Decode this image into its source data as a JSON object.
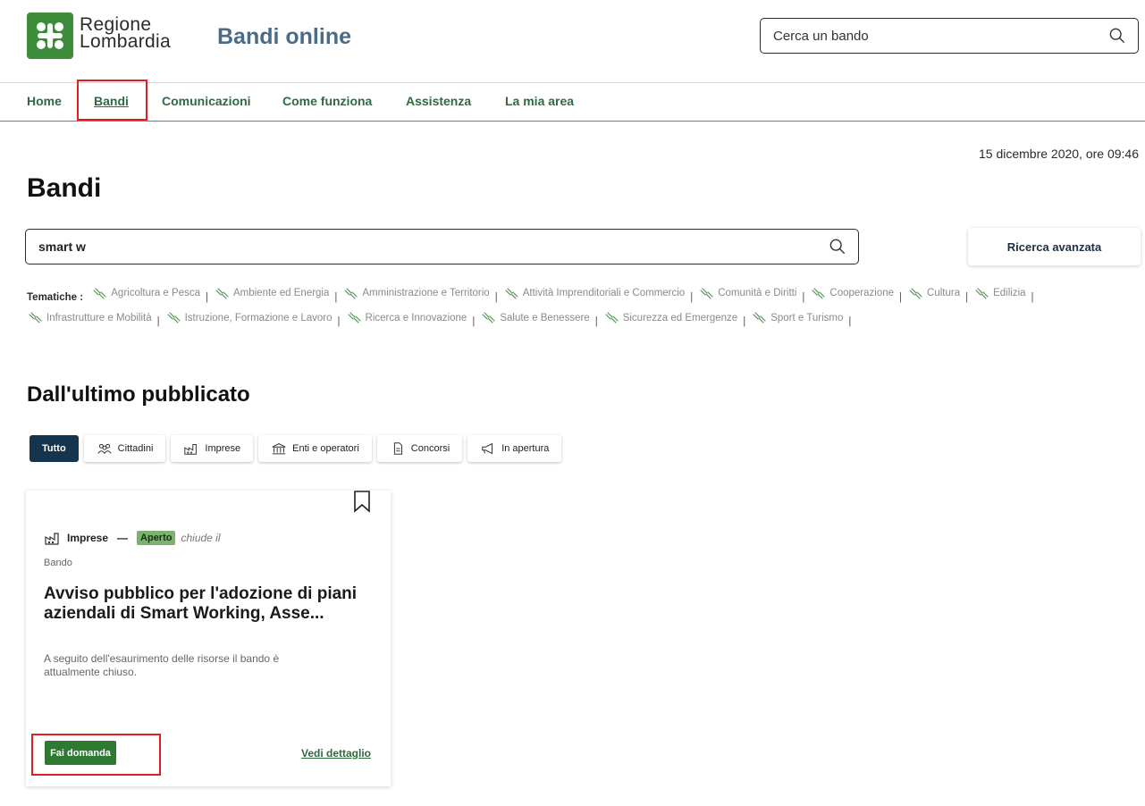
{
  "header": {
    "brand_line1": "Regione",
    "brand_line2": "Lombardia",
    "site_title": "Bandi online",
    "search_placeholder": "Cerca un bando"
  },
  "nav": {
    "items": [
      {
        "label": "Home"
      },
      {
        "label": "Bandi",
        "active": true
      },
      {
        "label": "Comunicazioni"
      },
      {
        "label": "Come funziona"
      },
      {
        "label": "Assistenza"
      },
      {
        "label": "La mia area"
      }
    ]
  },
  "date": "15 dicembre 2020, ore 09:46",
  "page_title": "Bandi",
  "search": {
    "value": "smart w",
    "advanced_label": "Ricerca avanzata"
  },
  "tematiche": {
    "label": "Tematiche :",
    "items": [
      "Agricoltura e Pesca",
      "Ambiente ed Energia",
      "Amministrazione e Territorio",
      "Attività Imprenditoriali e Commercio",
      "Comunità e Diritti",
      "Cooperazione",
      "Cultura",
      "Edilizia",
      "Infrastrutture e Mobilità",
      "Istruzione, Formazione e Lavoro",
      "Ricerca e Innovazione",
      "Salute e Benessere",
      "Sicurezza ed Emergenze",
      "Sport e Turismo"
    ]
  },
  "section_title": "Dall'ultimo pubblicato",
  "filters": {
    "all": "Tutto",
    "cittadini": "Cittadini",
    "imprese": "Imprese",
    "enti": "Enti e operatori",
    "concorsi": "Concorsi",
    "apertura": "In apertura"
  },
  "card": {
    "category": "Imprese",
    "status": "Aperto",
    "closes": "chiude il",
    "type": "Bando",
    "title": "Avviso pubblico per l'adozione di piani aziendali di Smart Working, Asse...",
    "description": "A seguito dell'esaurimento delle risorse il bando è attualmente chiuso.",
    "apply_label": "Fai domanda",
    "detail_label": "Vedi dettaglio"
  },
  "colors": {
    "brand_green": "#3d8c3a",
    "nav_green": "#2f6a3e",
    "title_blue": "#4a6c88",
    "active_filter": "#15344d",
    "apply_button": "#2f7a33",
    "highlight_red": "#e11d24"
  }
}
